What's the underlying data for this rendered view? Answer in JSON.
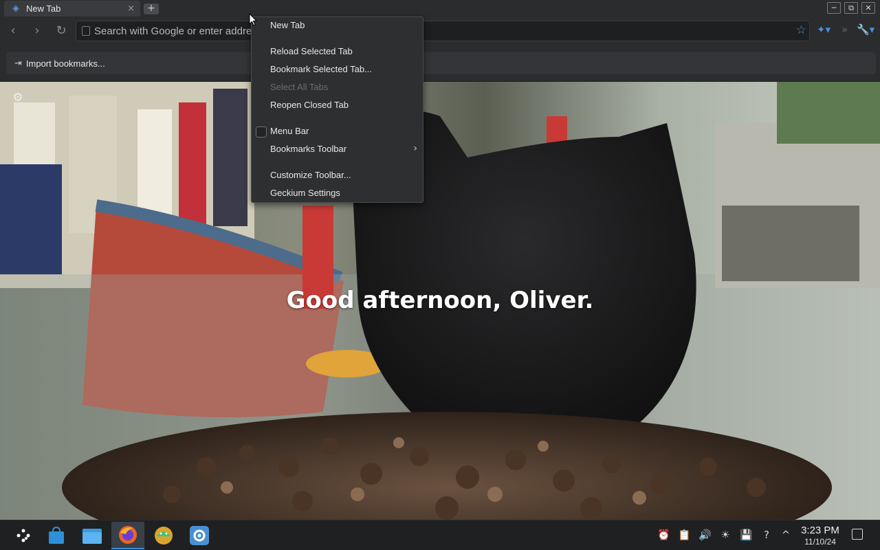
{
  "tab": {
    "title": "New Tab",
    "close_glyph": "×",
    "icon": "browser-logo-icon"
  },
  "newtab_glyph": "+",
  "window_controls": {
    "minimize": "─",
    "maximize": "⧉",
    "close": "✕"
  },
  "toolbar": {
    "back_glyph": "‹",
    "forward_glyph": "›",
    "reload_glyph": "↻"
  },
  "urlbar": {
    "placeholder": "Search with Google or enter address",
    "value": ""
  },
  "bookmarks": {
    "import_label": "Import bookmarks..."
  },
  "greeting": "Good afternoon, Oliver.",
  "context_menu": {
    "items": [
      {
        "label": "New Tab"
      },
      {
        "label": "Reload Selected Tab"
      },
      {
        "label": "Bookmark Selected Tab..."
      },
      {
        "label": "Select All Tabs"
      },
      {
        "label": "Reopen Closed Tab"
      },
      {
        "label": "Menu Bar"
      },
      {
        "label": "Bookmarks Toolbar"
      },
      {
        "label": "Customize Toolbar..."
      },
      {
        "label": "Geckium Settings"
      }
    ]
  },
  "taskbar": {
    "apps": [
      "app-launcher-icon",
      "discover-store-icon",
      "file-manager-icon",
      "firefox-icon",
      "android-app-icon",
      "steam-icon"
    ],
    "tray": [
      "notifications-icon",
      "clipboard-icon",
      "volume-icon",
      "brightness-icon",
      "storage-icon",
      "help-icon",
      "tray-expand-icon"
    ]
  },
  "clock": {
    "time": "3:23 PM",
    "date": "11/10/24"
  },
  "colors": {
    "accent": "#3d8fd8",
    "menu_bg": "#2e2f31",
    "chrome_bg": "#2b2c2e"
  }
}
